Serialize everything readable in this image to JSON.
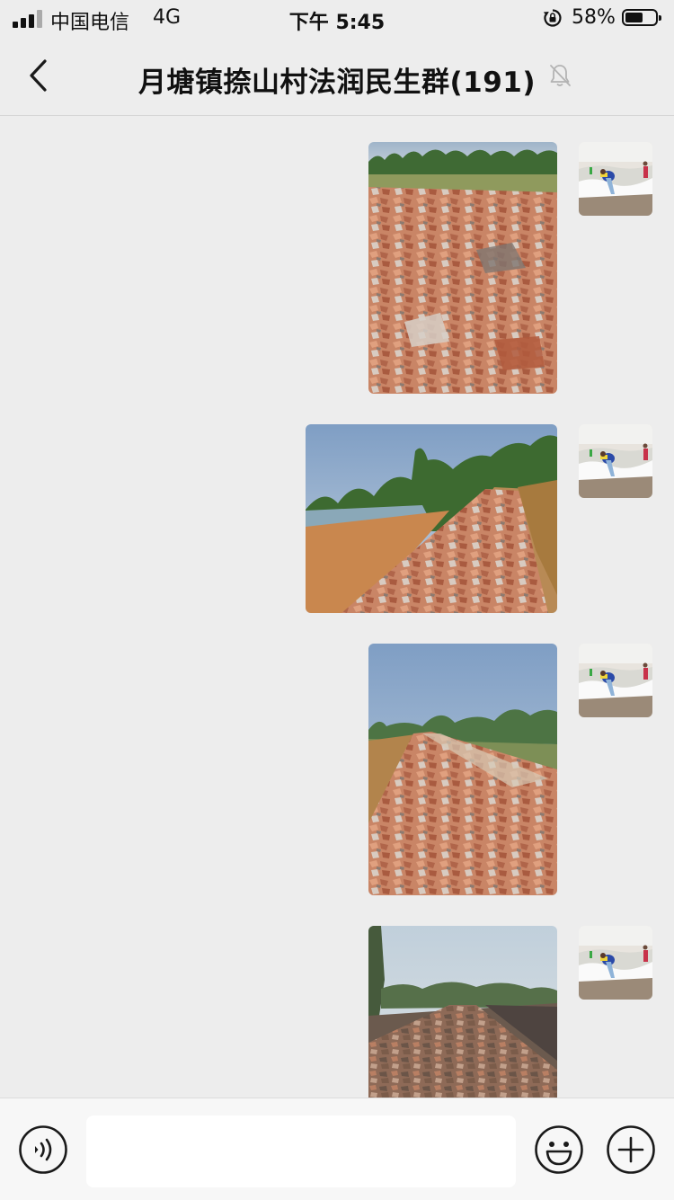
{
  "status_bar": {
    "carrier": "中国电信",
    "network": "4G",
    "time": "下午 5:45",
    "battery_percent": "58%",
    "battery_level": 0.58,
    "icons": [
      "signal-bars-icon",
      "rotation-lock-icon",
      "battery-icon"
    ]
  },
  "nav": {
    "title": "月塘镇捺山村法润民生群(191)",
    "icons": [
      "back-chevron-icon",
      "muted-bell-icon"
    ]
  },
  "messages": [
    {
      "type": "image",
      "sender": "self",
      "content": "rubble brick road photo"
    },
    {
      "type": "image",
      "sender": "self",
      "content": "rubble road beside pond photo"
    },
    {
      "type": "image",
      "sender": "self",
      "content": "curving rubble road photo"
    },
    {
      "type": "image",
      "sender": "self",
      "content": "long rubble road photo"
    }
  ],
  "input_bar": {
    "input_value": "",
    "icons": [
      "voice-icon",
      "emoji-icon",
      "plus-icon"
    ]
  },
  "colors": {
    "background": "#ededed",
    "input_bar": "#f7f7f7",
    "text": "#111111",
    "icon": "#1a1a1a"
  }
}
